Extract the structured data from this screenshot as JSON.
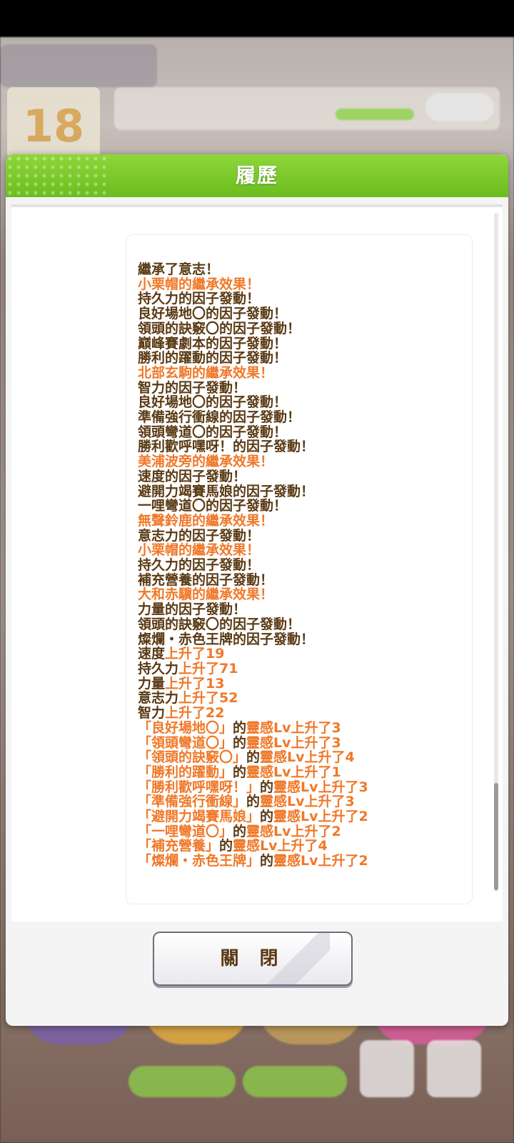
{
  "background": {
    "day_number": "18"
  },
  "dialog": {
    "title": "履歷",
    "close_label": "關 閉"
  },
  "log": [
    [
      {
        "t": "繼承了意志！",
        "c": "n"
      }
    ],
    [
      {
        "t": "小栗帽的繼承效果！",
        "c": "o"
      }
    ],
    [
      {
        "t": "持久力的因子發動！",
        "c": "n"
      }
    ],
    [
      {
        "t": "良好場地〇的因子發動！",
        "c": "n"
      }
    ],
    [
      {
        "t": "領頭的訣竅〇的因子發動！",
        "c": "n"
      }
    ],
    [
      {
        "t": "巔峰賽劇本的因子發動！",
        "c": "n"
      }
    ],
    [
      {
        "t": "勝利的躍動的因子發動！",
        "c": "n"
      }
    ],
    [
      {
        "t": "北部玄駒的繼承效果！",
        "c": "o"
      }
    ],
    [
      {
        "t": "智力的因子發動！",
        "c": "n"
      }
    ],
    [
      {
        "t": "良好場地〇的因子發動！",
        "c": "n"
      }
    ],
    [
      {
        "t": "準備強行衝線的因子發動！",
        "c": "n"
      }
    ],
    [
      {
        "t": "領頭彎道〇的因子發動！",
        "c": "n"
      }
    ],
    [
      {
        "t": "勝利歡呼嘿呀！的因子發動！",
        "c": "n"
      }
    ],
    [
      {
        "t": "美浦波旁的繼承效果！",
        "c": "o"
      }
    ],
    [
      {
        "t": "速度的因子發動！",
        "c": "n"
      }
    ],
    [
      {
        "t": "避開力竭賽馬娘的因子發動！",
        "c": "n"
      }
    ],
    [
      {
        "t": "一哩彎道〇的因子發動！",
        "c": "n"
      }
    ],
    [
      {
        "t": "無聲鈴鹿的繼承效果！",
        "c": "o"
      }
    ],
    [
      {
        "t": "意志力的因子發動！",
        "c": "n"
      }
    ],
    [
      {
        "t": "小栗帽的繼承效果！",
        "c": "o"
      }
    ],
    [
      {
        "t": "持久力的因子發動！",
        "c": "n"
      }
    ],
    [
      {
        "t": "補充營養的因子發動！",
        "c": "n"
      }
    ],
    [
      {
        "t": "大和赤驥的繼承效果！",
        "c": "o"
      }
    ],
    [
      {
        "t": "力量的因子發動！",
        "c": "n"
      }
    ],
    [
      {
        "t": "領頭的訣竅〇的因子發動！",
        "c": "n"
      }
    ],
    [
      {
        "t": "燦爛・赤色王牌的因子發動！",
        "c": "n"
      }
    ],
    [
      {
        "t": "速度",
        "c": "n"
      },
      {
        "t": "上升了19",
        "c": "o"
      }
    ],
    [
      {
        "t": "持久力",
        "c": "n"
      },
      {
        "t": "上升了71",
        "c": "o"
      }
    ],
    [
      {
        "t": "力量",
        "c": "n"
      },
      {
        "t": "上升了13",
        "c": "o"
      }
    ],
    [
      {
        "t": "意志力",
        "c": "n"
      },
      {
        "t": "上升了52",
        "c": "o"
      }
    ],
    [
      {
        "t": "智力",
        "c": "n"
      },
      {
        "t": "上升了22",
        "c": "o"
      }
    ],
    [
      {
        "t": "「良好場地〇」",
        "c": "o"
      },
      {
        "t": "的",
        "c": "n"
      },
      {
        "t": "靈感Lv上升了3",
        "c": "o"
      }
    ],
    [
      {
        "t": "「領頭彎道〇」",
        "c": "o"
      },
      {
        "t": "的",
        "c": "n"
      },
      {
        "t": "靈感Lv上升了3",
        "c": "o"
      }
    ],
    [
      {
        "t": "「領頭的訣竅〇」",
        "c": "o"
      },
      {
        "t": "的",
        "c": "n"
      },
      {
        "t": "靈感Lv上升了4",
        "c": "o"
      }
    ],
    [
      {
        "t": "「勝利的躍動」",
        "c": "o"
      },
      {
        "t": "的",
        "c": "n"
      },
      {
        "t": "靈感Lv上升了1",
        "c": "o"
      }
    ],
    [
      {
        "t": "「勝利歡呼嘿呀！」",
        "c": "o"
      },
      {
        "t": "的",
        "c": "n"
      },
      {
        "t": "靈感Lv上升了3",
        "c": "o"
      }
    ],
    [
      {
        "t": "「準備強行衝線」",
        "c": "o"
      },
      {
        "t": "的",
        "c": "n"
      },
      {
        "t": "靈感Lv上升了3",
        "c": "o"
      }
    ],
    [
      {
        "t": "「避開力竭賽馬娘」",
        "c": "o"
      },
      {
        "t": "的",
        "c": "n"
      },
      {
        "t": "靈感Lv上升了2",
        "c": "o"
      }
    ],
    [
      {
        "t": "「一哩彎道〇」",
        "c": "o"
      },
      {
        "t": "的",
        "c": "n"
      },
      {
        "t": "靈感Lv上升了2",
        "c": "o"
      }
    ],
    [
      {
        "t": "「補充營養」",
        "c": "o"
      },
      {
        "t": "的",
        "c": "n"
      },
      {
        "t": "靈感Lv上升了4",
        "c": "o"
      }
    ],
    [
      {
        "t": "「燦爛・赤色王牌」",
        "c": "o"
      },
      {
        "t": "的",
        "c": "n"
      },
      {
        "t": "靈感Lv上升了2",
        "c": "o"
      }
    ]
  ],
  "colors": {
    "header_green": "#7cc72a",
    "text_brown": "#5a3a14",
    "highlight_orange": "#f07828"
  }
}
